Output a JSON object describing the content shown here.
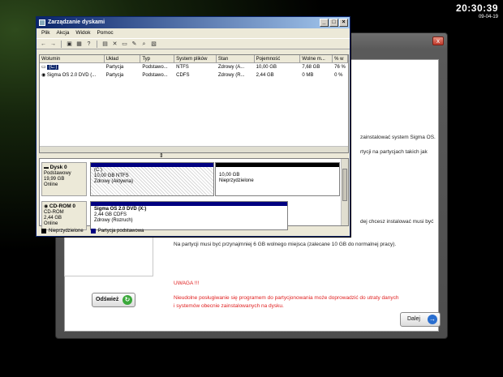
{
  "clock": {
    "time": "20:30:39",
    "date": "09-04-19"
  },
  "installer": {
    "close_glyph": "x",
    "lines": [
      "zainstalować system Sigma OS.",
      "rtycji na partycjach takich jak",
      "dej chcesz instalować musi być",
      "Na partycji musi być przynajmniej 6 GB wolnego miejsca (zalecane 10 GB do normalnej pracy)."
    ],
    "warning_title": "UWAGA !!!",
    "warning_lines": [
      "Nieudolne posługiwanie się programem do partycjonowania może doprowadzić do utraty danych",
      "i systemów obecnie zainstalowanych na dysku."
    ],
    "refresh_label": "Odśwież",
    "next_label": "Dalej",
    "refresh_icon": "refresh-icon",
    "next_icon": "arrow-right-icon"
  },
  "disk_mgmt": {
    "title": "Zarządzanie dyskami",
    "window_buttons": {
      "minimize": "_",
      "maximize": "□",
      "close": "×"
    },
    "menu": [
      "Plik",
      "Akcja",
      "Widok",
      "Pomoc"
    ],
    "toolbar_icons": [
      "back-icon",
      "forward-icon",
      "up-icon",
      "properties-icon",
      "help-icon",
      "delete-icon",
      "folder-icon",
      "new-icon",
      "search-icon",
      "drive-icon"
    ],
    "columns": [
      "Wolumin",
      "Układ",
      "Typ",
      "System plików",
      "Stan",
      "Pojemność",
      "Wolne m...",
      "% w"
    ],
    "rows": [
      [
        "(C:)",
        "Partycja",
        "Podstawo...",
        "NTFS",
        "Zdrowy (A...",
        "10,00 GB",
        "7,68 GB",
        "76 %"
      ],
      [
        "Sigma OS 2.0 DVD (...",
        "Partycja",
        "Podstawo...",
        "CDFS",
        "Zdrowy (R...",
        "2,44 GB",
        "0 MB",
        "0 %"
      ]
    ],
    "disks": [
      {
        "name": "Dysk 0",
        "type": "Podstawowy",
        "size": "19,99 GB",
        "status": "Online",
        "partitions": [
          {
            "label": "(C:)",
            "detail": "10,00 GB NTFS",
            "state": "Zdrowy (Aktywna)",
            "kind": "primary"
          },
          {
            "label": "",
            "detail": "10,00 GB",
            "state": "Nieprzydzielone",
            "kind": "unallocated"
          }
        ]
      },
      {
        "name": "CD-ROM 0",
        "type": "CD-ROM",
        "size": "2,44 GB",
        "status": "Online",
        "partitions": [
          {
            "label": "Sigma OS 2.0 DVD (X:)",
            "detail": "2,44 GB CDFS",
            "state": "Zdrowy (Rozruch)",
            "kind": "primary"
          }
        ]
      }
    ],
    "legend": [
      "Nieprzydzielone",
      "Partycja podstawowa"
    ],
    "colors": {
      "primary": "#000080",
      "unallocated": "#000000",
      "title_start": "#0a246a",
      "title_end": "#a6caf0"
    }
  }
}
